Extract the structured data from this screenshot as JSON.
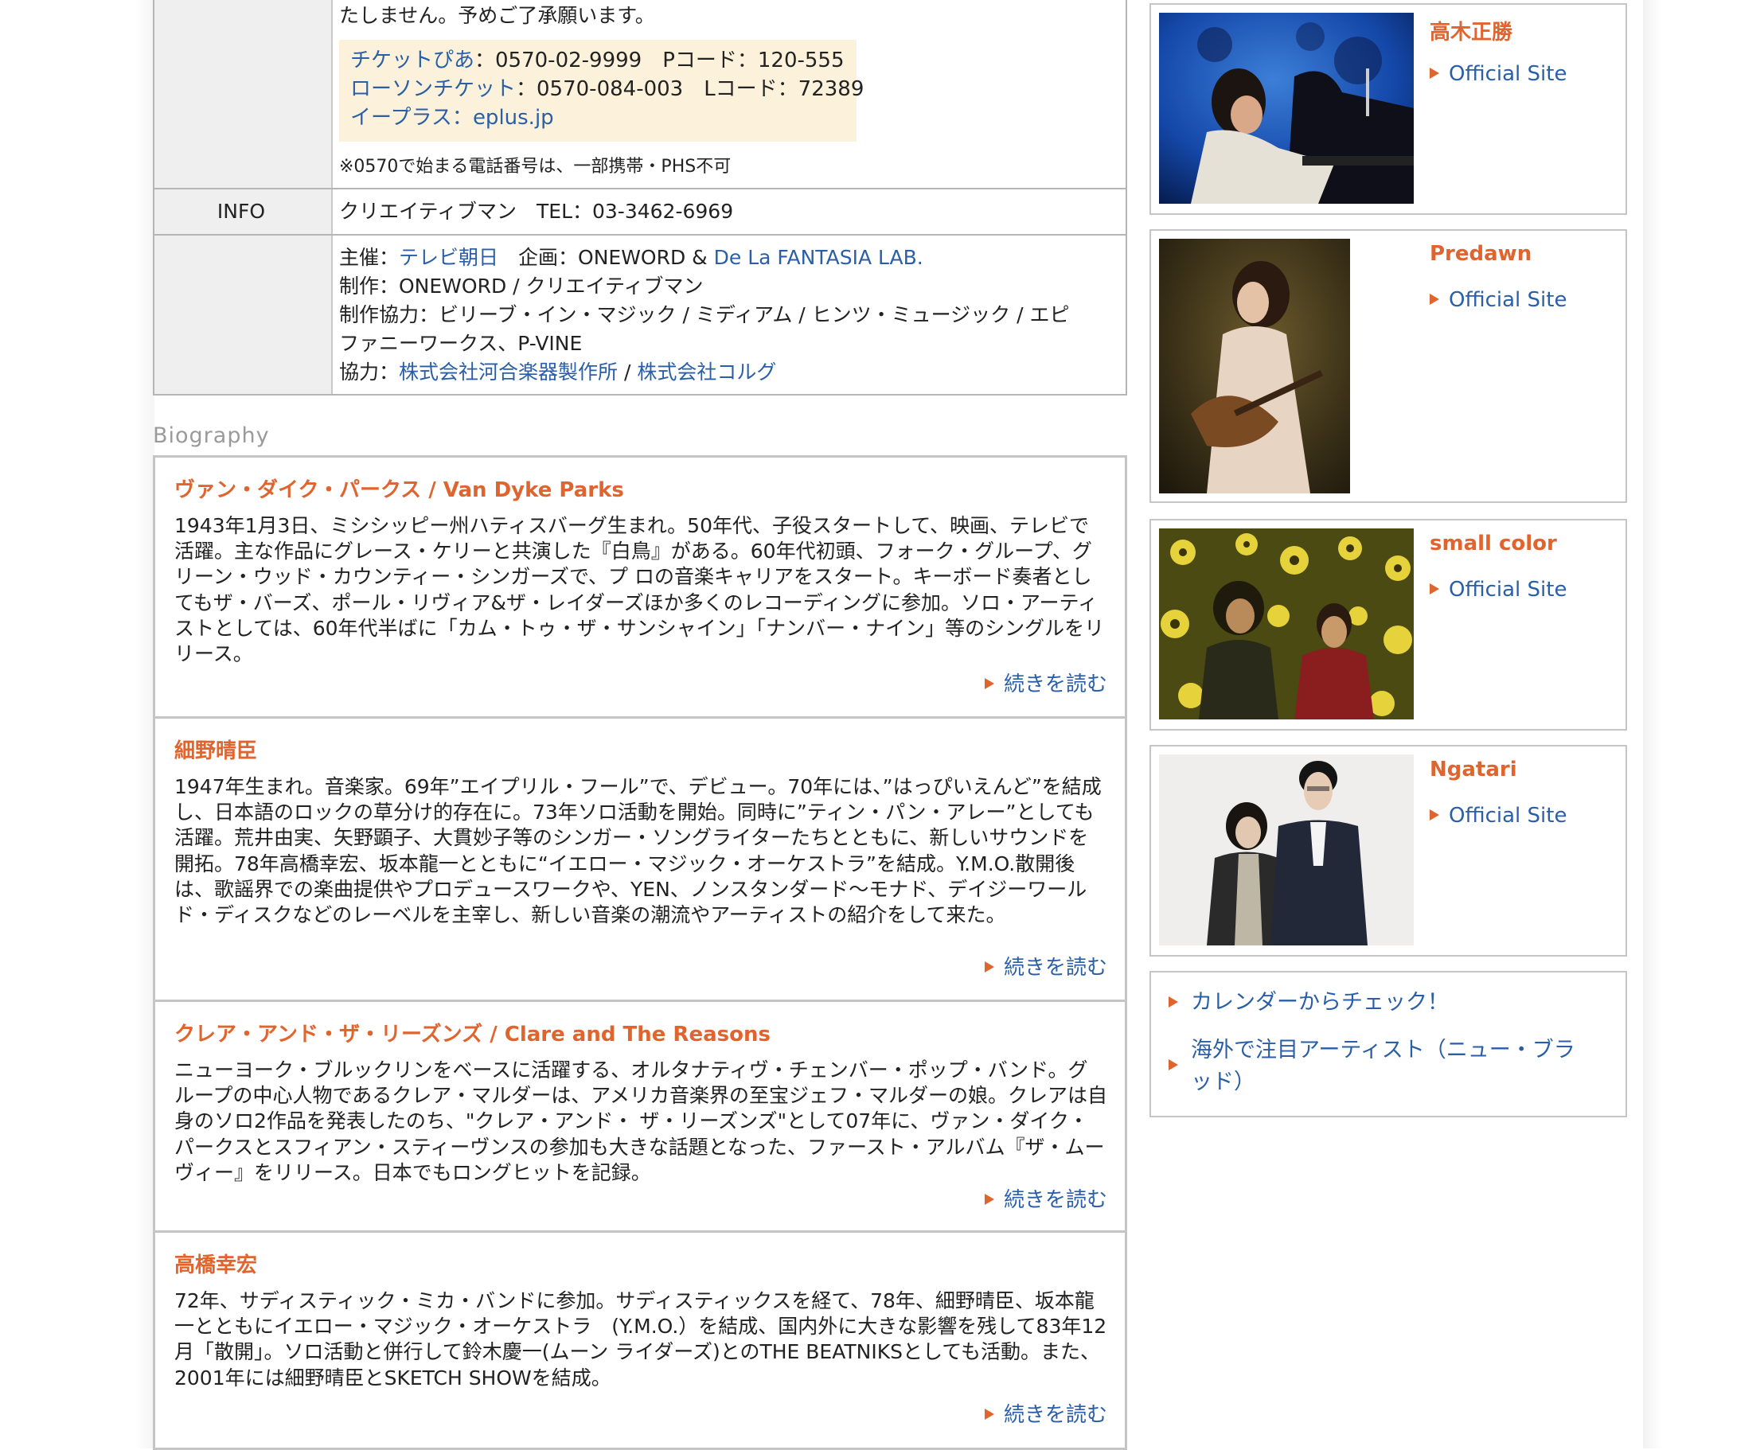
{
  "info_table": {
    "ticket_note_top": "たしません。予めご了承願います。",
    "tickets": [
      {
        "vendor": "チケットぴあ",
        "detail": "：0570-02-9999　Pコード：120-555"
      },
      {
        "vendor": "ローソンチケット",
        "detail": "：0570-084-003　Lコード：72389"
      },
      {
        "vendor": "イープラス",
        "sep": "：",
        "site": "eplus.jp"
      }
    ],
    "phone_note": "※0570で始まる電話番号は、一部携帯・PHS不可",
    "info_label": "INFO",
    "info_value": "クリエイティブマン　TEL：03-3462-6969",
    "credits": {
      "sponsor_label": "主催：",
      "sponsor": "テレビ朝日",
      "plan_label": "　企画：ONEWORD & ",
      "plan_link": "De La FANTASIA LAB.",
      "production": "制作：ONEWORD / クリエイティブマン",
      "cooperation_1": "制作協力：ビリーブ・イン・マジック / ミディアム / ヒンツ・ミュージック / エピ",
      "cooperation_2": "ファニーワークス、P-VINE",
      "support_label": "協力：",
      "support_1": "株式会社河合楽器製作所",
      "support_sep": " / ",
      "support_2": "株式会社コルグ"
    }
  },
  "biography": {
    "heading": "Biography",
    "read_more": "続きを読む",
    "entries": [
      {
        "name": "ヴァン・ダイク・パークス / Van Dyke Parks",
        "text": "1943年1月3日、ミシシッピー州ハティスバーグ生まれ。50年代、子役スタートして、映画、テレビで活躍。主な作品にグレース・ケリーと共演した『白鳥』がある。60年代初頭、フォーク・グループ、グリーン・ウッド・カウンティー・シンガーズで、プ ロの音楽キャリアをスタート。キーボード奏者としてもザ・バーズ、ポール・リヴィア&ザ・レイダーズほか多くのレコーディングに参加。ソロ・アーティストとしては、60年代半ばに「カム・トゥ・ザ・サンシャイン」「ナンバー・ナイン」等のシングルをリリース。"
      },
      {
        "name": "細野晴臣",
        "text": "1947年生まれ。音楽家。69年”エイプリル・フール”で、デビュー。70年には、”はっぴいえんど”を結成し、日本語のロックの草分け的存在に。73年ソロ活動を開始。同時に”ティン・パン・アレー”としても活躍。荒井由実、矢野顕子、大貫妙子等のシンガー・ソングライターたちとともに、新しいサウンドを開拓。78年高橋幸宏、坂本龍一とともに“イエロー・マジック・オーケストラ”を結成。Y.M.O.散開後は、歌謡界での楽曲提供やプロデュースワークや、YEN、ノンスタンダード〜モナド、デイジーワールド・ディスクなどのレーベルを主宰し、新しい音楽の潮流やアーティストの紹介をして来た。"
      },
      {
        "name": "クレア・アンド・ザ・リーズンズ / Clare and The Reasons",
        "text": "ニューヨーク・ブルックリンをベースに活躍する、オルタナティヴ・チェンバー・ポップ・バンド。グループの中心人物であるクレア・マルダーは、アメリカ音楽界の至宝ジェフ・マルダーの娘。クレアは自身のソロ2作品を発表したのち、\"クレア・アンド・ ザ・リーズンズ\"として07年に、ヴァン・ダイク・パークスとスフィアン・スティーヴンスの参加も大きな話題となった、ファースト・アルバム『ザ・ムーヴィー』をリリース。日本でもロングヒットを記録。"
      },
      {
        "name": "高橋幸宏",
        "text": "72年、サディスティック・ミカ・バンドに参加。サディスティックスを経て、78年、細野晴臣、坂本龍一とともにイエロー・マジック・オーケストラ　(Y.M.O.）を結成、国内外に大きな影響を残して83年12月「散開」。ソロ活動と併行して鈴木慶一(ムーン ライダーズ)とのTHE BEATNIKSとしても活動。また、2001年には細野晴臣とSKETCH SHOWを結成。"
      }
    ]
  },
  "artists": [
    {
      "name": "高木正勝",
      "link": "Official Site"
    },
    {
      "name": "Predawn",
      "link": "Official Site"
    },
    {
      "name": "small color",
      "link": "Official Site"
    },
    {
      "name": "Ngatari",
      "link": "Official Site"
    }
  ],
  "side_links": [
    {
      "label": "カレンダーからチェック！"
    },
    {
      "label": "海外で注目アーティスト（ニュー・ブラッド）"
    }
  ],
  "colors": {
    "accent_orange": "#e0642e",
    "link_blue": "#2a5fa8",
    "ticket_bg": "#fcf2dc",
    "label_bg": "#efefef"
  }
}
